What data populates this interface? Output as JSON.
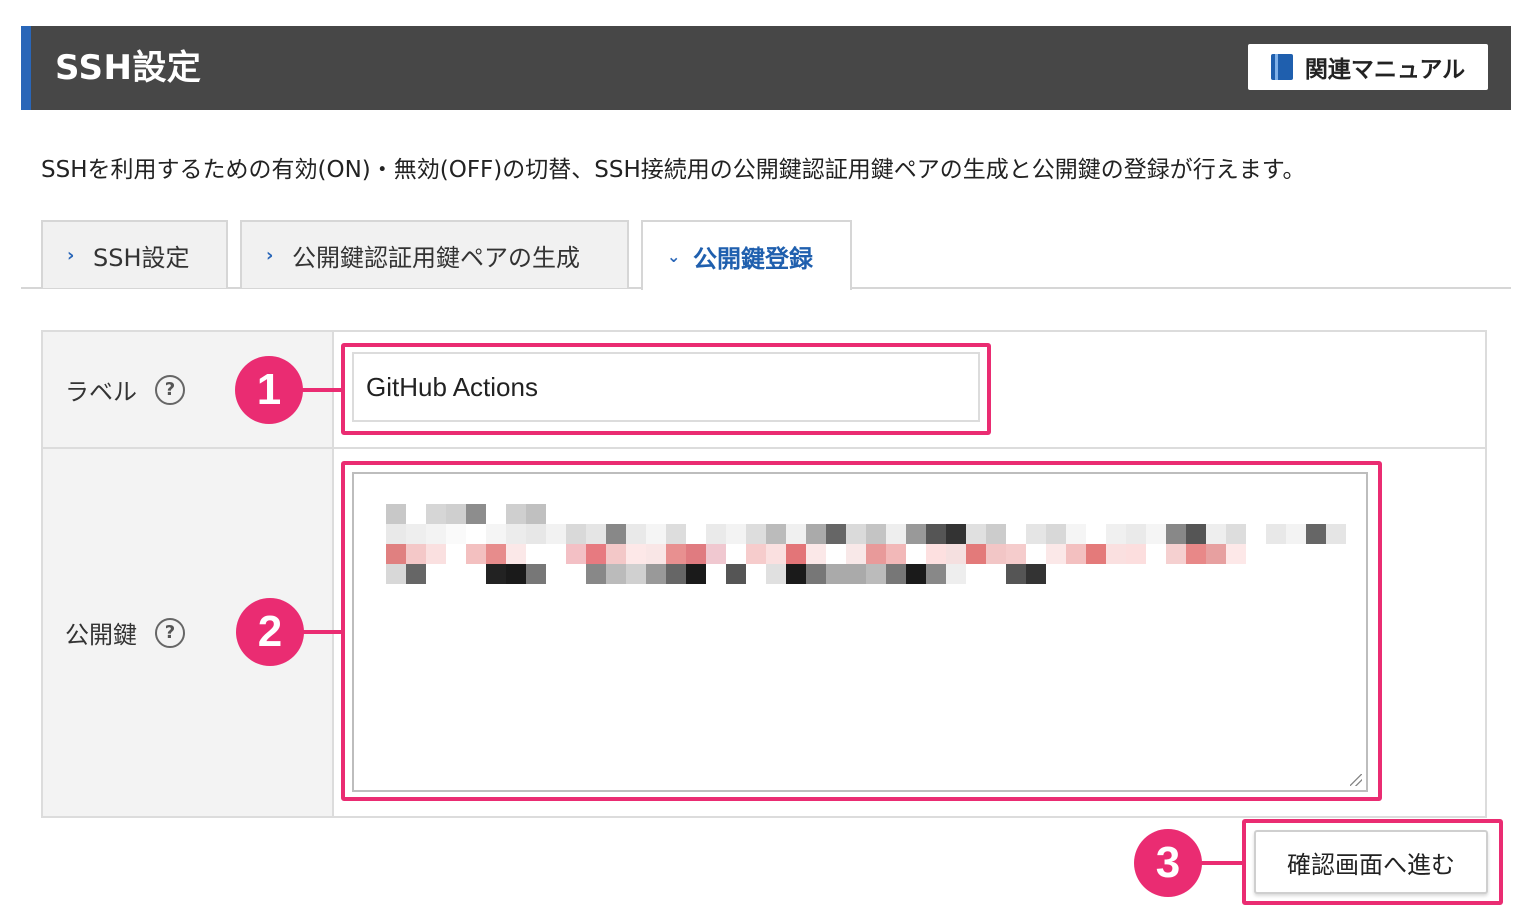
{
  "header": {
    "title": "SSH設定",
    "manual_button": "関連マニュアル"
  },
  "description": "SSHを利用するための有効(ON)・無効(OFF)の切替、SSH接続用の公開鍵認証用鍵ペアの生成と公開鍵の登録が行えます。",
  "tabs": [
    {
      "label": "SSH設定",
      "active": false
    },
    {
      "label": "公開鍵認証用鍵ペアの生成",
      "active": false
    },
    {
      "label": "公開鍵登録",
      "active": true
    }
  ],
  "form": {
    "label_field": {
      "label": "ラベル",
      "value": "GitHub Actions"
    },
    "public_key_field": {
      "label": "公開鍵"
    },
    "help_glyph": "?"
  },
  "submit_button": "確認画面へ進む",
  "callouts": [
    "1",
    "2",
    "3"
  ],
  "colors": {
    "accent": "#2966b8",
    "header_bg": "#474747",
    "callout": "#ea2c72"
  }
}
